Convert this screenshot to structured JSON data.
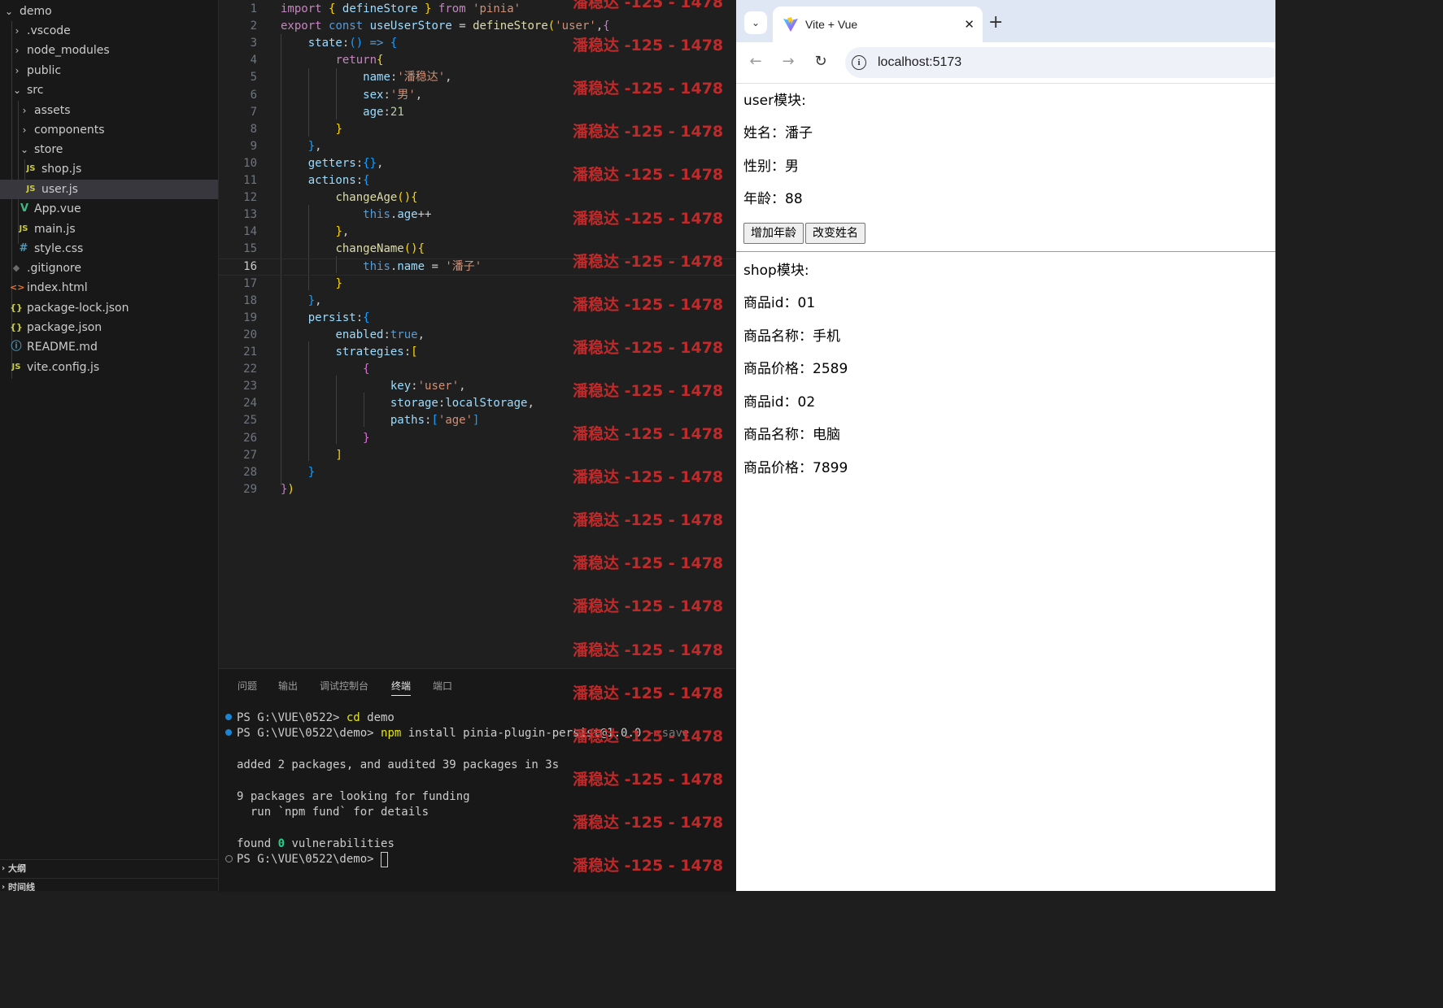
{
  "explorer": {
    "items": [
      {
        "label": "demo",
        "type": "folder",
        "open": true
      },
      {
        "label": ".vscode",
        "type": "folder",
        "open": false
      },
      {
        "label": "node_modules",
        "type": "folder",
        "open": false
      },
      {
        "label": "public",
        "type": "folder",
        "open": false
      },
      {
        "label": "src",
        "type": "folder",
        "open": true
      },
      {
        "label": "assets",
        "type": "folder",
        "open": false
      },
      {
        "label": "components",
        "type": "folder",
        "open": false
      },
      {
        "label": "store",
        "type": "folder",
        "open": true
      },
      {
        "label": "shop.js",
        "type": "js",
        "icon": "JS"
      },
      {
        "label": "user.js",
        "type": "js",
        "icon": "JS",
        "selected": true
      },
      {
        "label": "App.vue",
        "type": "vue",
        "icon": "V"
      },
      {
        "label": "main.js",
        "type": "js",
        "icon": "JS"
      },
      {
        "label": "style.css",
        "type": "css",
        "icon": "#"
      },
      {
        "label": ".gitignore",
        "type": "git",
        "icon": "◆"
      },
      {
        "label": "index.html",
        "type": "html",
        "icon": "<>"
      },
      {
        "label": "package-lock.json",
        "type": "json",
        "icon": "{}"
      },
      {
        "label": "package.json",
        "type": "json",
        "icon": "{}"
      },
      {
        "label": "README.md",
        "type": "info",
        "icon": "ⓘ"
      },
      {
        "label": "vite.config.js",
        "type": "js",
        "icon": "JS"
      }
    ],
    "outline_label": "大纲",
    "timeline_label": "时间线"
  },
  "editor": {
    "active_line": 16,
    "lines": [
      "import { defineStore } from 'pinia'",
      "export const useUserStore = defineStore('user',{",
      "    state:() => {",
      "        return{",
      "            name:'潘稳达',",
      "            sex:'男',",
      "            age:21",
      "        }",
      "    },",
      "    getters:{},",
      "    actions:{",
      "        changeAge(){",
      "            this.age++",
      "        },",
      "        changeName(){",
      "            this.name = '潘子'",
      "        }",
      "    },",
      "    persist:{",
      "        enabled:true,",
      "        strategies:[",
      "            {",
      "                key:'user',",
      "                storage:localStorage,",
      "                paths:['age']",
      "            }",
      "        ]",
      "    }",
      "})"
    ]
  },
  "panel": {
    "tabs": [
      {
        "label": "问题",
        "active": false
      },
      {
        "label": "输出",
        "active": false
      },
      {
        "label": "调试控制台",
        "active": false
      },
      {
        "label": "终端",
        "active": true
      },
      {
        "label": "端口",
        "active": false
      }
    ],
    "terminal": {
      "line1_prompt": "PS G:\\VUE\\0522> ",
      "line1_cmd": "cd",
      "line1_arg": " demo",
      "line2_prompt": "PS G:\\VUE\\0522\\demo> ",
      "line2_cmd": "npm",
      "line2_arg": " install pinia-plugin-persist@1.0.0 ",
      "line2_flag": "--save",
      "out1": "added 2 packages, and audited 39 packages in 3s",
      "out2": "9 packages are looking for funding",
      "out3": "  run `npm fund` for details",
      "out4_pre": "found ",
      "out4_num": "0",
      "out4_post": " vulnerabilities",
      "last_prompt": "PS G:\\VUE\\0522\\demo> "
    }
  },
  "watermark": {
    "text": "潘稳达 -125 - 1478",
    "color": "#ce2b2b",
    "count": 21
  },
  "browser": {
    "tab_title": "Vite + Vue",
    "url": "localhost:5173",
    "page": {
      "user_heading": "user模块:",
      "name_line": "姓名：潘子",
      "sex_line": "性别：男",
      "age_line": "年龄：88",
      "btn_add_age": "增加年龄",
      "btn_change_name": "改变姓名",
      "shop_heading": "shop模块:",
      "products": [
        {
          "id_line": "商品id：01",
          "name_line": "商品名称：手机",
          "price_line": "商品价格：2589"
        },
        {
          "id_line": "商品id：02",
          "name_line": "商品名称：电脑",
          "price_line": "商品价格：7899"
        }
      ]
    }
  }
}
